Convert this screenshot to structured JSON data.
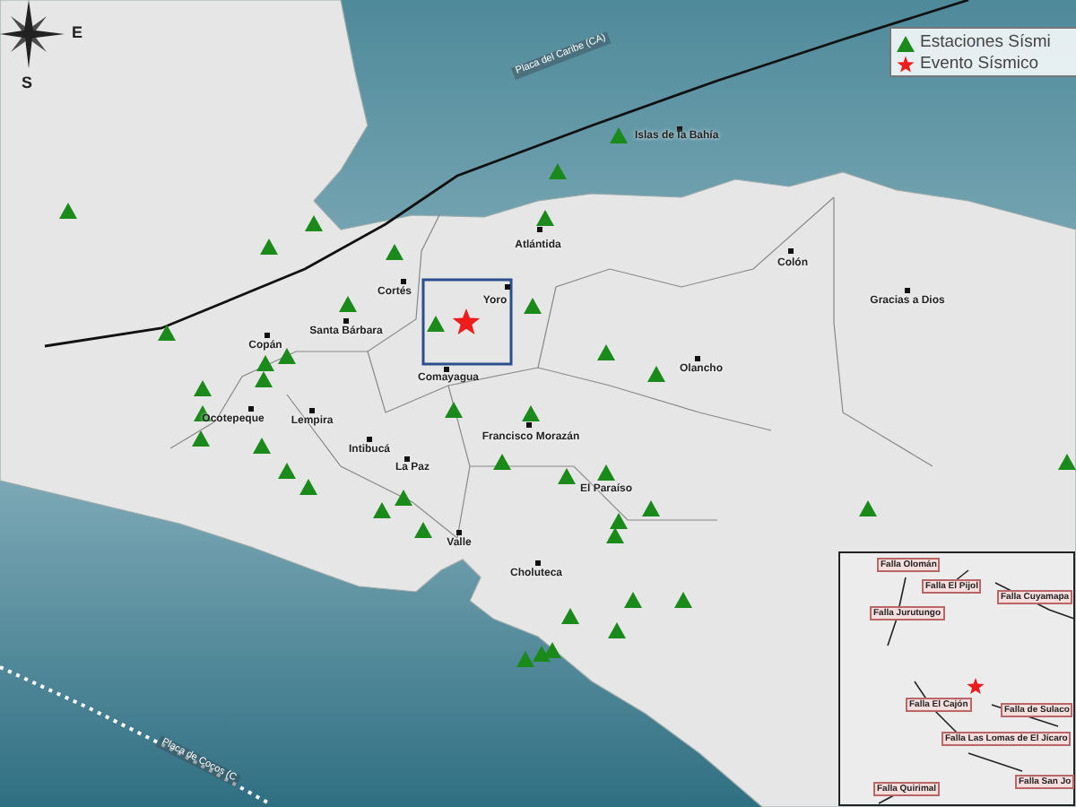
{
  "compass": {
    "east": "E",
    "south": "S"
  },
  "legend": [
    {
      "kind": "station",
      "label": "Estaciones Sísmi"
    },
    {
      "kind": "event",
      "label": "Evento Sísmico"
    }
  ],
  "plates": [
    {
      "label": "Placa del Caribe (CA)"
    },
    {
      "label": "Placa de Cocos (C"
    }
  ],
  "departments": [
    "Islas de la Bahía",
    "Atlántida",
    "Colón",
    "Gracias a Dios",
    "Yoro",
    "Cortés",
    "Santa Bárbara",
    "Copán",
    "Ocotepeque",
    "Lempira",
    "Intibucá",
    "La Paz",
    "Comayagua",
    "Francisco Morazán",
    "Olancho",
    "El Paraíso",
    "Valle",
    "Choluteca"
  ],
  "inset": {
    "faults": [
      "Falla Olomán",
      "Falla El Pijol",
      "Falla Cuyamapa",
      "Falla Jurutungo",
      "Falla El Cajón",
      "Falla de Sulaco",
      "Falla Las Lomas de El Jícaro",
      "Falla San Jo",
      "Falla Quirimal"
    ]
  }
}
